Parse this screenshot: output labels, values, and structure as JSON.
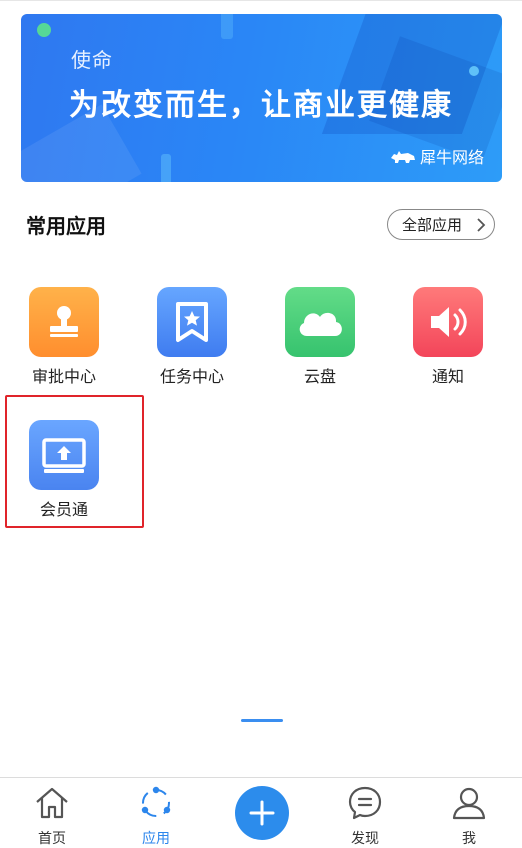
{
  "banner": {
    "small_text": "使命",
    "headline": "为改变而生，让商业更健康",
    "brand": "犀牛网络"
  },
  "section": {
    "title": "常用应用",
    "all_apps_label": "全部应用"
  },
  "apps": [
    {
      "label": "审批中心",
      "icon": "stamp-icon",
      "color": "#ff9a38"
    },
    {
      "label": "任务中心",
      "icon": "bookmark-star-icon",
      "color": "#4f8ef5"
    },
    {
      "label": "云盘",
      "icon": "cloud-icon",
      "color": "#45cc78"
    },
    {
      "label": "通知",
      "icon": "speaker-icon",
      "color": "#f55a66"
    },
    {
      "label": "会员通",
      "icon": "upload-tray-icon",
      "color": "#5a94f4"
    }
  ],
  "nav": {
    "items": [
      {
        "label": "首页",
        "icon": "home-icon"
      },
      {
        "label": "应用",
        "icon": "apps-circle-icon",
        "active": true
      },
      {
        "label": "",
        "icon": "plus-icon"
      },
      {
        "label": "发现",
        "icon": "chat-bubble-icon"
      },
      {
        "label": "我",
        "icon": "user-icon"
      }
    ]
  },
  "colors": {
    "accent": "#2c86ec",
    "highlight_border": "#e0242a"
  }
}
